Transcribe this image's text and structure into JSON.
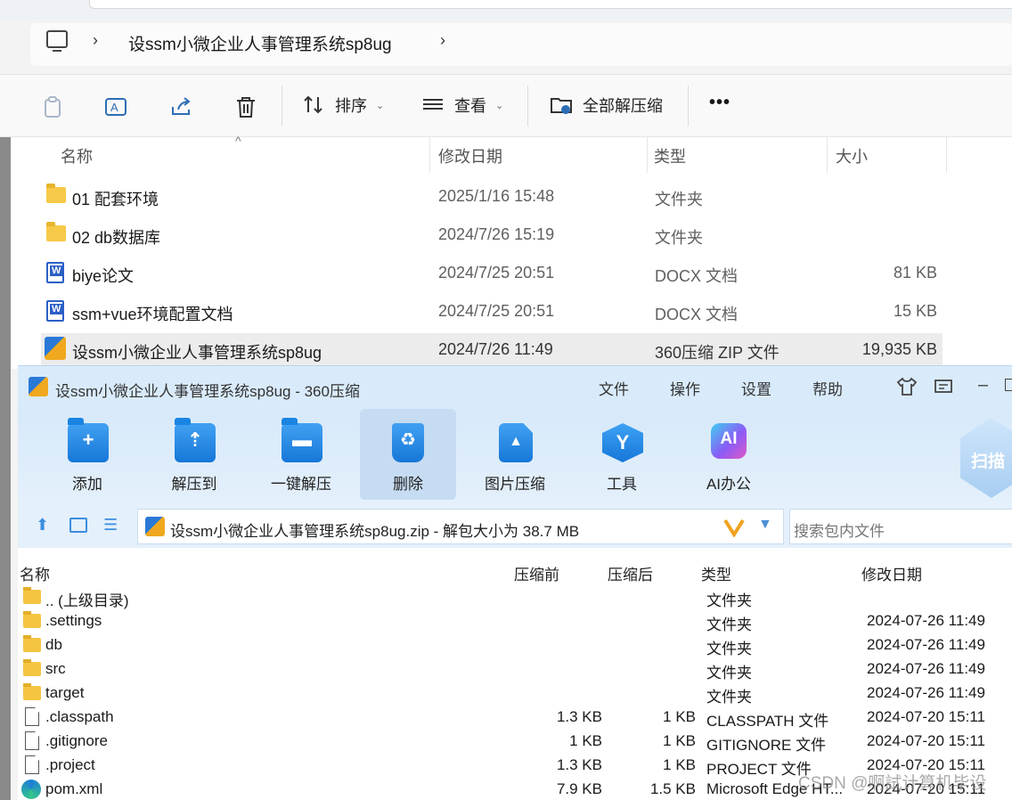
{
  "explorer": {
    "breadcrumb": "设ssm小微企业人事管理系统sp8ug",
    "toolbar": {
      "sort_label": "排序",
      "view_label": "查看",
      "extract_all_label": "全部解压缩",
      "more_label": "•••"
    },
    "columns": [
      "名称",
      "修改日期",
      "类型",
      "大小"
    ],
    "rows": [
      {
        "name": "01 配套环境",
        "date": "2025/1/16 15:48",
        "type": "文件夹",
        "size": "",
        "icon": "folder-icon"
      },
      {
        "name": "02 db数据库",
        "date": "2024/7/26 15:19",
        "type": "文件夹",
        "size": "",
        "icon": "folder-icon"
      },
      {
        "name": "biye论文",
        "date": "2024/7/25 20:51",
        "type": "DOCX 文档",
        "size": "81 KB",
        "icon": "word-doc-icon"
      },
      {
        "name": "ssm+vue环境配置文档",
        "date": "2024/7/25 20:51",
        "type": "DOCX 文档",
        "size": "15 KB",
        "icon": "word-doc-icon"
      },
      {
        "name": "设ssm小微企业人事管理系统sp8ug",
        "date": "2024/7/26 11:49",
        "type": "360压缩 ZIP 文件",
        "size": "19,935 KB",
        "icon": "zip-360-icon"
      }
    ]
  },
  "zip_window": {
    "title": "设ssm小微企业人事管理系统sp8ug - 360压缩",
    "menu": [
      "文件",
      "操作",
      "设置",
      "帮助"
    ],
    "ribbon": [
      {
        "label": "添加",
        "glyph": "+"
      },
      {
        "label": "解压到",
        "glyph": "⇡"
      },
      {
        "label": "一键解压",
        "glyph": "▬"
      },
      {
        "label": "删除",
        "glyph": "♻"
      },
      {
        "label": "图片压缩",
        "glyph": "▲"
      },
      {
        "label": "工具",
        "glyph": "Y"
      },
      {
        "label": "AI办公",
        "glyph": "AI"
      }
    ],
    "scan_label": "扫描",
    "path": "设ssm小微企业人事管理系统sp8ug.zip - 解包大小为 38.7 MB",
    "search_placeholder": "搜索包内文件",
    "columns": [
      "名称",
      "压缩前",
      "压缩后",
      "类型",
      "修改日期"
    ],
    "rows": [
      {
        "name": ".. (上级目录)",
        "before": "",
        "after": "",
        "type": "文件夹",
        "date": "",
        "icon": "folder-icon"
      },
      {
        "name": ".settings",
        "before": "",
        "after": "",
        "type": "文件夹",
        "date": "2024-07-26 11:49",
        "icon": "folder-icon"
      },
      {
        "name": "db",
        "before": "",
        "after": "",
        "type": "文件夹",
        "date": "2024-07-26 11:49",
        "icon": "folder-icon"
      },
      {
        "name": "src",
        "before": "",
        "after": "",
        "type": "文件夹",
        "date": "2024-07-26 11:49",
        "icon": "folder-icon"
      },
      {
        "name": "target",
        "before": "",
        "after": "",
        "type": "文件夹",
        "date": "2024-07-26 11:49",
        "icon": "folder-icon"
      },
      {
        "name": ".classpath",
        "before": "1.3 KB",
        "after": "1 KB",
        "type": "CLASSPATH 文件",
        "date": "2024-07-20 15:11",
        "icon": "file-icon"
      },
      {
        "name": ".gitignore",
        "before": "1 KB",
        "after": "1 KB",
        "type": "GITIGNORE 文件",
        "date": "2024-07-20 15:11",
        "icon": "file-icon"
      },
      {
        "name": ".project",
        "before": "1.3 KB",
        "after": "1 KB",
        "type": "PROJECT 文件",
        "date": "2024-07-20 15:11",
        "icon": "file-icon"
      },
      {
        "name": "pom.xml",
        "before": "7.9 KB",
        "after": "1.5 KB",
        "type": "Microsoft Edge HT...",
        "date": "2024-07-20 15:11",
        "icon": "edge-icon"
      }
    ]
  },
  "watermark": "CSDN @啊試计算机毕设"
}
